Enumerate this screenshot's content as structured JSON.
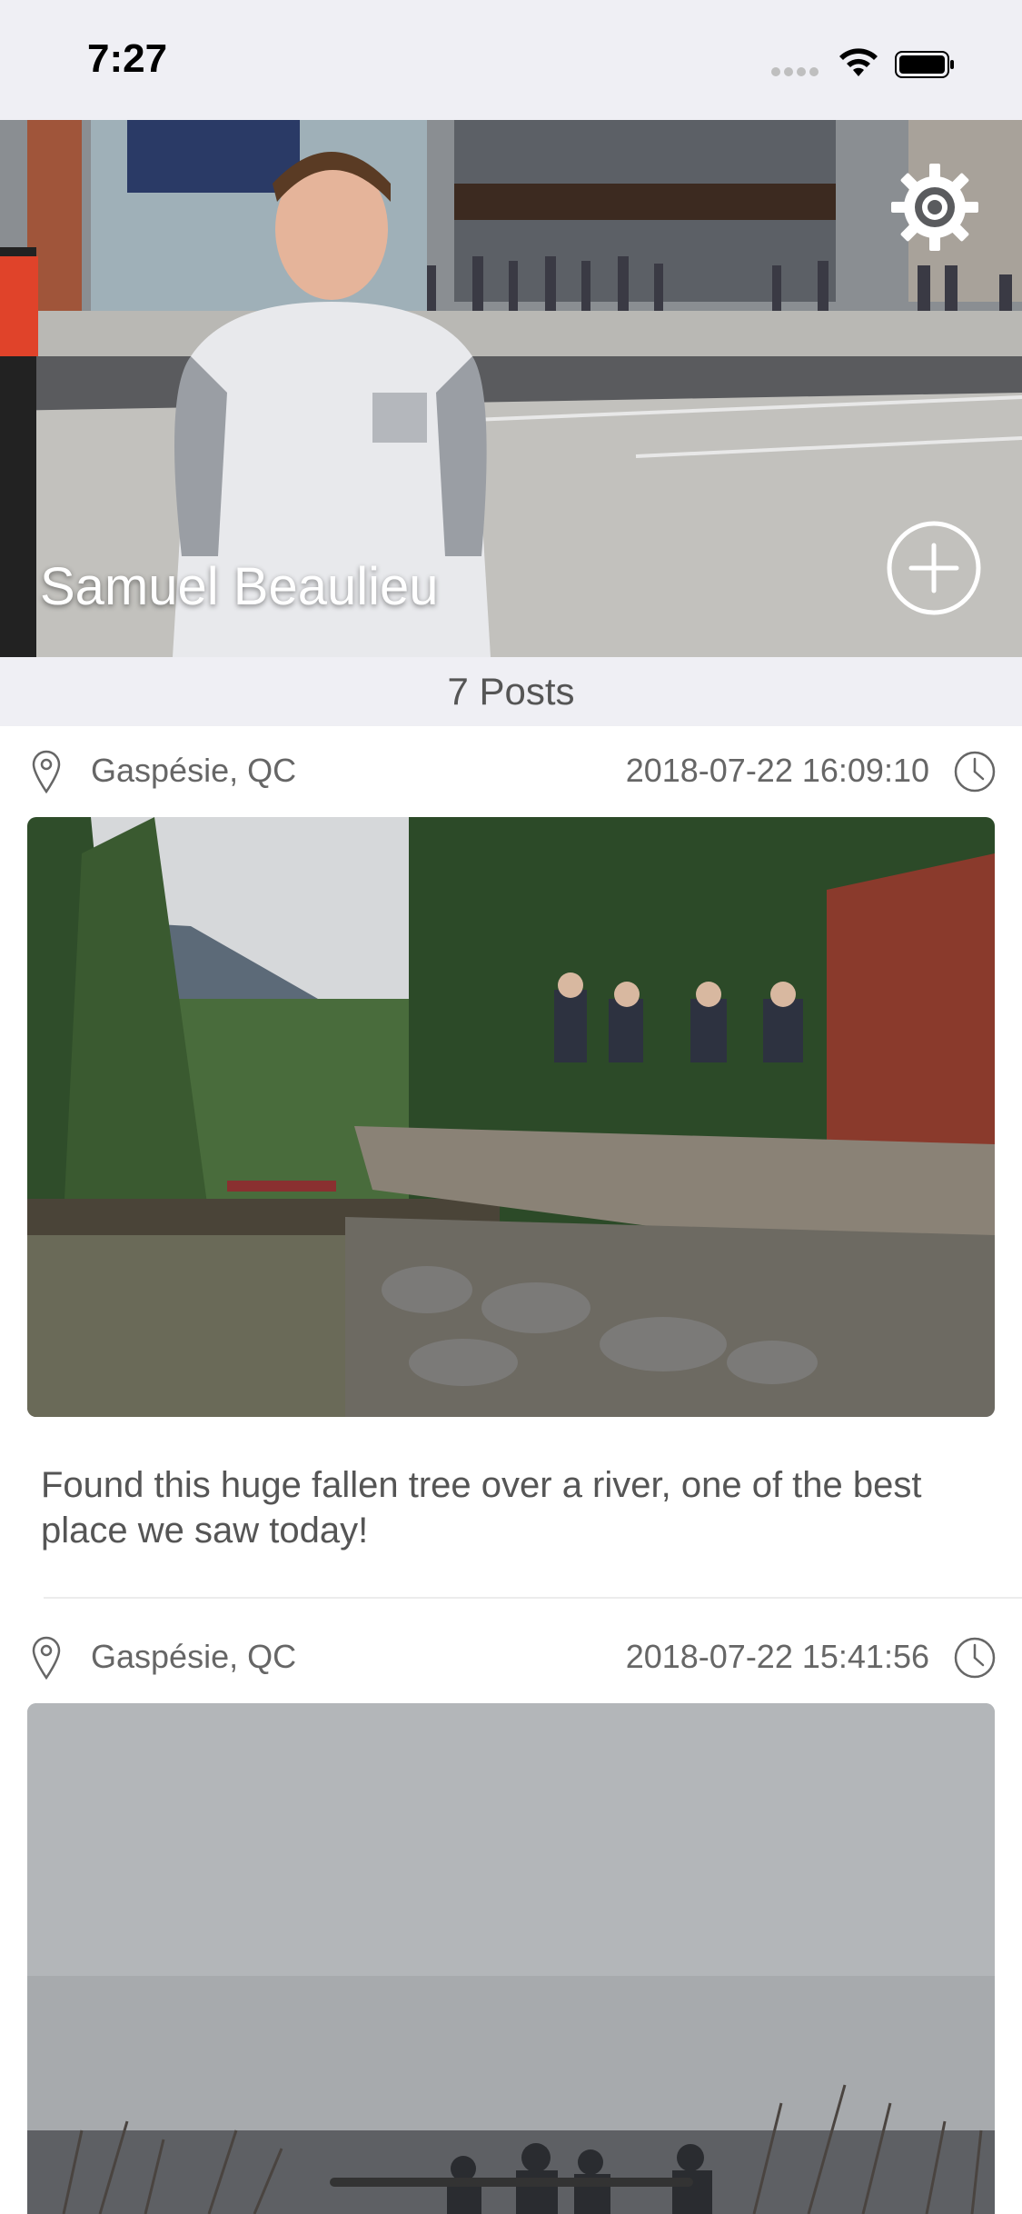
{
  "status_bar": {
    "time": "7:27"
  },
  "profile": {
    "name": "Samuel Beaulieu",
    "settings_icon": "gear-icon",
    "add_icon": "plus-circle-icon"
  },
  "posts_summary": {
    "count_label": "7 Posts"
  },
  "posts": [
    {
      "location": "Gaspésie, QC",
      "timestamp": "2018-07-22 16:09:10",
      "caption": "Found this huge fallen tree over a river, one of the best place we saw today!",
      "photo_description_icon": "photo"
    },
    {
      "location": "Gaspésie, QC",
      "timestamp": "2018-07-22 15:41:56",
      "caption": "",
      "photo_description_icon": "photo"
    }
  ],
  "colors": {
    "background": "#ffffff",
    "status_bar_bg": "#efeff4",
    "meta_text": "#666666",
    "caption_text": "#555555"
  }
}
